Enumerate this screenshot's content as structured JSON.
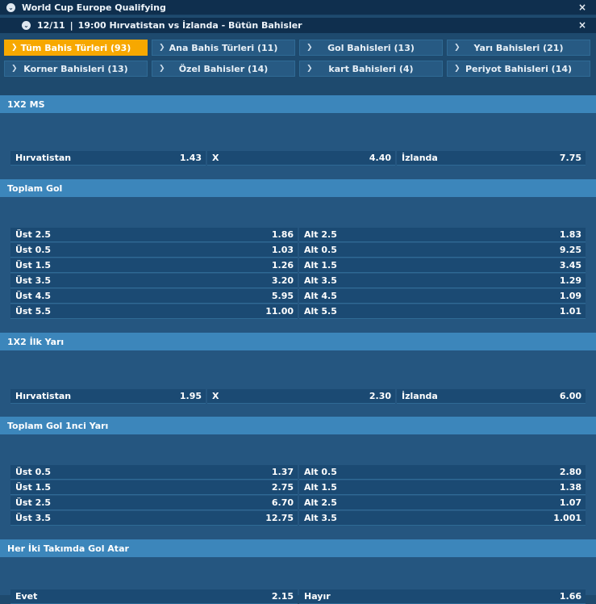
{
  "header": {
    "competition": "World Cup Europe Qualifying",
    "match_date": "12/11",
    "match_sep": "|",
    "match_info": "19:00 Hırvatistan vs İzlanda - Bütün Bahisler",
    "close_glyph": "×",
    "chevron_glyph": "⌄"
  },
  "tabs": [
    {
      "label": "Tüm Bahis Türleri (93)",
      "active": true
    },
    {
      "label": "Ana Bahis Türleri (11)",
      "active": false
    },
    {
      "label": "Gol Bahisleri (13)",
      "active": false
    },
    {
      "label": "Yarı Bahisleri (21)",
      "active": false
    },
    {
      "label": "Korner Bahisleri (13)",
      "active": false
    },
    {
      "label": "Özel Bahisler (14)",
      "active": false
    },
    {
      "label": "kart Bahisleri (4)",
      "active": false
    },
    {
      "label": "Periyot Bahisleri (14)",
      "active": false
    }
  ],
  "tab_arrow": "❯",
  "markets": [
    {
      "title": "1X2 MS",
      "layout": "3col",
      "rows": [
        [
          {
            "label": "Hırvatistan",
            "odd": "1.43"
          },
          {
            "label": "X",
            "odd": "4.40"
          },
          {
            "label": "İzlanda",
            "odd": "7.75"
          }
        ]
      ]
    },
    {
      "title": "Toplam Gol",
      "layout": "2col",
      "rows": [
        [
          {
            "label": "Üst 2.5",
            "odd": "1.86"
          },
          {
            "label": "Alt 2.5",
            "odd": "1.83"
          }
        ],
        [
          {
            "label": "Üst 0.5",
            "odd": "1.03"
          },
          {
            "label": "Alt 0.5",
            "odd": "9.25"
          }
        ],
        [
          {
            "label": "Üst 1.5",
            "odd": "1.26"
          },
          {
            "label": "Alt 1.5",
            "odd": "3.45"
          }
        ],
        [
          {
            "label": "Üst 3.5",
            "odd": "3.20"
          },
          {
            "label": "Alt 3.5",
            "odd": "1.29"
          }
        ],
        [
          {
            "label": "Üst 4.5",
            "odd": "5.95"
          },
          {
            "label": "Alt 4.5",
            "odd": "1.09"
          }
        ],
        [
          {
            "label": "Üst 5.5",
            "odd": "11.00"
          },
          {
            "label": "Alt 5.5",
            "odd": "1.01"
          }
        ]
      ]
    },
    {
      "title": "1X2 İlk Yarı",
      "layout": "3col",
      "rows": [
        [
          {
            "label": "Hırvatistan",
            "odd": "1.95"
          },
          {
            "label": "X",
            "odd": "2.30"
          },
          {
            "label": "İzlanda",
            "odd": "6.00"
          }
        ]
      ]
    },
    {
      "title": "Toplam Gol 1nci Yarı",
      "layout": "2col",
      "rows": [
        [
          {
            "label": "Üst 0.5",
            "odd": "1.37"
          },
          {
            "label": "Alt 0.5",
            "odd": "2.80"
          }
        ],
        [
          {
            "label": "Üst 1.5",
            "odd": "2.75"
          },
          {
            "label": "Alt 1.5",
            "odd": "1.38"
          }
        ],
        [
          {
            "label": "Üst 2.5",
            "odd": "6.70"
          },
          {
            "label": "Alt 2.5",
            "odd": "1.07"
          }
        ],
        [
          {
            "label": "Üst 3.5",
            "odd": "12.75"
          },
          {
            "label": "Alt 3.5",
            "odd": "1.001"
          }
        ]
      ]
    },
    {
      "title": "Her İki Takımda Gol Atar",
      "layout": "2col",
      "rows": [
        [
          {
            "label": "Evet",
            "odd": "2.15"
          },
          {
            "label": "Hayır",
            "odd": "1.66"
          }
        ]
      ]
    }
  ]
}
